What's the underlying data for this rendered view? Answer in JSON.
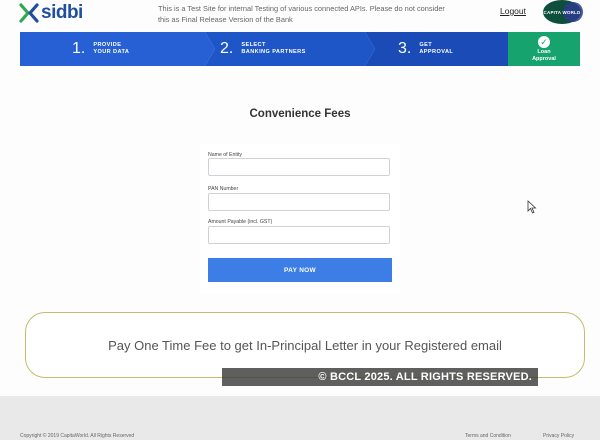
{
  "header": {
    "logo_text": "sidbi",
    "notice": "This is a Test Site for internal Testing of various connected APIs. Please do not consider this as Final Release Version of the Bank",
    "logout_label": "Logout",
    "avatar_text": "CAPITA WORLD"
  },
  "stepper": {
    "steps": [
      {
        "num": "1.",
        "label_line1": "PROVIDE",
        "label_line2": "YOUR DATA"
      },
      {
        "num": "2.",
        "label_line1": "SELECT",
        "label_line2": "BANKING PARTNERS"
      },
      {
        "num": "3.",
        "label_line1": "GET",
        "label_line2": "APPROVAL"
      }
    ],
    "done": {
      "label_line1": "Loan",
      "label_line2": "Approval"
    }
  },
  "form": {
    "title": "Convenience Fees",
    "fields": [
      {
        "label": "Name of Entity",
        "value": ""
      },
      {
        "label": "PAN Number",
        "value": ""
      },
      {
        "label": "Amount Payable (incl. GST)",
        "value": ""
      }
    ],
    "submit_label": "PAY NOW"
  },
  "banner": {
    "text": "Pay One Time Fee to get In-Principal Letter in  your Registered email"
  },
  "watermark": "© BCCL 2025. ALL RIGHTS RESERVED.",
  "footer": {
    "copyright": "Copyright © 2019 CapitaWorld. All Rights Reserved",
    "terms": "Terms and Condition",
    "privacy": "Privacy Policy"
  },
  "colors": {
    "stepper_blue": "#2b63d6",
    "stepper_done": "#16a36e",
    "button": "#3c7ee6",
    "banner_border": "#c2bd6a"
  }
}
